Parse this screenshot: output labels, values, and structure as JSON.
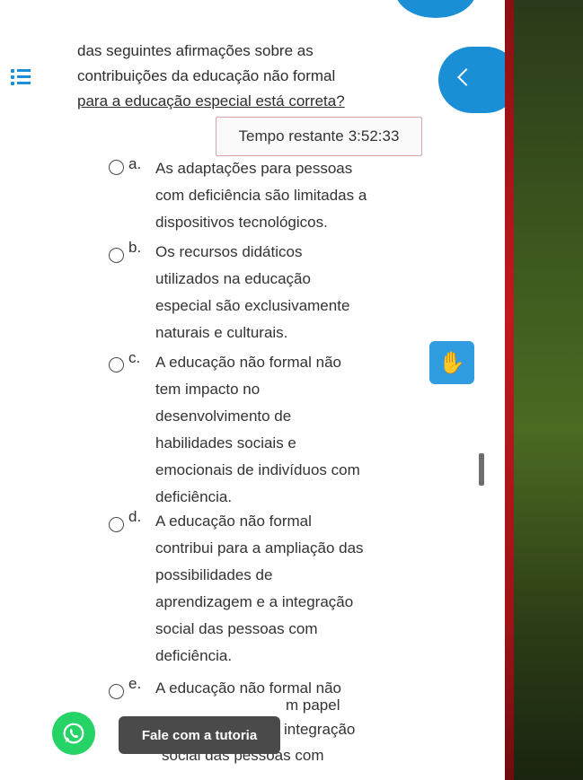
{
  "question": {
    "lines": [
      "das seguintes afirmações sobre as",
      "contribuições da educação não formal",
      "para a educação especial está correta?"
    ]
  },
  "timer": {
    "label": "Tempo restante",
    "value": "3:52:33"
  },
  "options": [
    {
      "letter": "a.",
      "lines": [
        "As adaptações para pessoas",
        "com deficiência são limitadas a",
        "dispositivos tecnológicos."
      ]
    },
    {
      "letter": "b.",
      "lines": [
        "Os recursos didáticos",
        "utilizados na educação",
        "especial são exclusivamente",
        "naturais e culturais."
      ]
    },
    {
      "letter": "c.",
      "lines": [
        "A educação não formal não",
        "tem impacto no",
        "desenvolvimento de",
        "habilidades sociais e",
        "emocionais de indivíduos com",
        "deficiência."
      ]
    },
    {
      "letter": "d.",
      "lines": [
        "A educação não formal",
        "contribui para a ampliação das",
        "possibilidades de",
        "aprendizagem e a integração",
        "social das pessoas com",
        "deficiência."
      ]
    },
    {
      "letter": "e.",
      "lines": [
        "A educação não formal não"
      ]
    }
  ],
  "option_e_continuation": {
    "covered": "m papel",
    "right": "integração",
    "last": "social das pessoas com"
  },
  "chat": {
    "label": "Fale com a tutoria"
  },
  "icons": {
    "menu": "list-icon",
    "back": "chevron-left-icon",
    "libras": "sign-language-icon",
    "whatsapp": "whatsapp-icon"
  },
  "colors": {
    "accent": "#1b8fd6",
    "chat_bg": "#4a4a4a",
    "whatsapp": "#25d366"
  }
}
